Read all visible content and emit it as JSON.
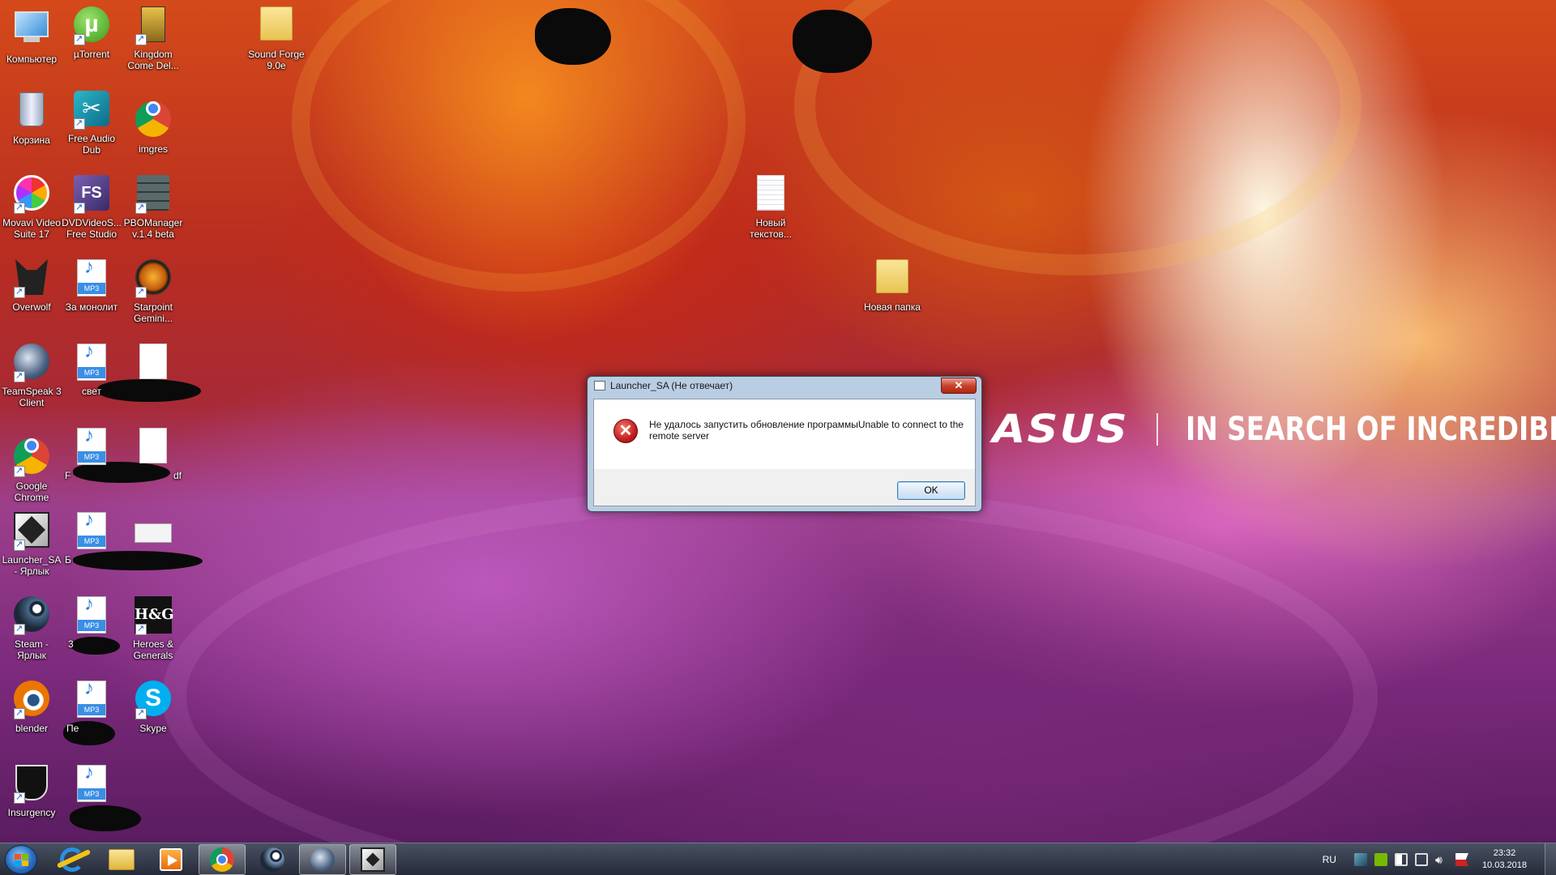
{
  "desktop": {
    "icons": [
      {
        "label": "Компьютер"
      },
      {
        "label": "µTorrent"
      },
      {
        "label": "Kingdom Come Del..."
      },
      {
        "label": "Sound Forge 9.0e"
      },
      {
        "label": "Корзина"
      },
      {
        "label": "Free Audio Dub"
      },
      {
        "label": "imgres"
      },
      {
        "label": "Movavi Video Suite 17"
      },
      {
        "label": "DVDVideoS... Free Studio"
      },
      {
        "label": "PBOManager v.1.4 beta"
      },
      {
        "label": "Новый текстов..."
      },
      {
        "label": "Overwolf"
      },
      {
        "label": "За монолит"
      },
      {
        "label": "Starpoint Gemini..."
      },
      {
        "label": "Новая папка"
      },
      {
        "label": "TeamSpeak 3 Client"
      },
      {
        "label": "свет"
      },
      {
        "label": "Google Chrome"
      },
      {
        "label": "F"
      },
      {
        "label": "df"
      },
      {
        "label": "Launcher_SA - Ярлык"
      },
      {
        "label": "Б"
      },
      {
        "label": "Steam - Ярлык"
      },
      {
        "label": "3"
      },
      {
        "label": "Heroes & Generals"
      },
      {
        "label": "blender"
      },
      {
        "label": "Пе"
      },
      {
        "label": "Skype"
      },
      {
        "label": "Insurgency"
      }
    ],
    "mp3_badge": "MP3",
    "fs_badge": "FS",
    "hg_badge": "H&G",
    "skype_badge": "S"
  },
  "brand": {
    "logo": "ASUS",
    "slogan": "IN SEARCH OF INCREDIBLE"
  },
  "dialog": {
    "title": "Launcher_SA (Не отвечает)",
    "close_label": "✕",
    "error_glyph": "✕",
    "message": "Не удалось запустить обновление программыUnable to connect to the remote server",
    "ok_label": "OK"
  },
  "taskbar": {
    "language": "RU",
    "time": "23:32",
    "date": "10.03.2018"
  },
  "colors": {
    "accent": "#3c7fb1",
    "error": "#c41e1e"
  }
}
